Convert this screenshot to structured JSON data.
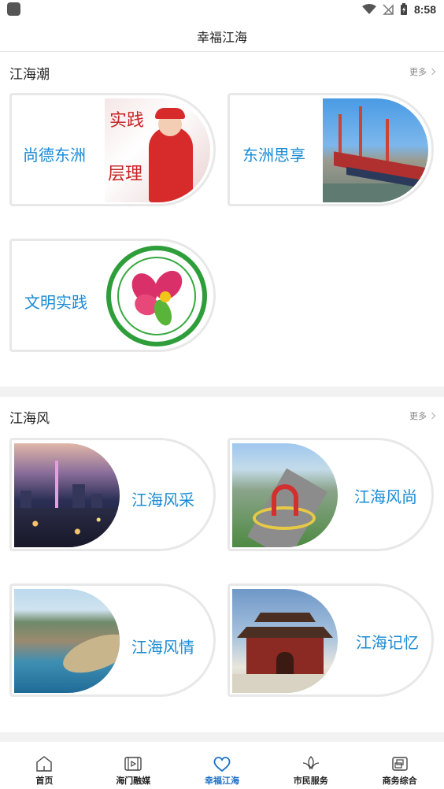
{
  "status_bar": {
    "time": "8:58"
  },
  "header": {
    "title": "幸福江海"
  },
  "sections": [
    {
      "title": "江海潮",
      "more": "更多",
      "cards": [
        {
          "label": "尚德东洲",
          "image": "volunteer-speaker-photo"
        },
        {
          "label": "东洲思享",
          "image": "shipyard-cranes-photo"
        },
        {
          "label": "文明实践",
          "image": "civilization-practice-logo"
        }
      ]
    },
    {
      "title": "江海风",
      "more": "更多",
      "cards": [
        {
          "label": "江海风采",
          "image": "city-night-skyline-photo"
        },
        {
          "label": "江海风尚",
          "image": "city-plaza-aerial-photo"
        },
        {
          "label": "江海风情",
          "image": "coastline-aerial-photo"
        },
        {
          "label": "江海记忆",
          "image": "traditional-temple-photo"
        }
      ]
    }
  ],
  "bottom_nav": [
    {
      "label": "首页",
      "icon": "home-icon",
      "active": false
    },
    {
      "label": "海门融媒",
      "icon": "media-play-icon",
      "active": false
    },
    {
      "label": "幸福江海",
      "icon": "heart-icon",
      "active": true
    },
    {
      "label": "市民服务",
      "icon": "leaf-hands-icon",
      "active": false
    },
    {
      "label": "商务综合",
      "icon": "business-icon",
      "active": false
    }
  ],
  "colors": {
    "accent": "#1a8bd4",
    "active_nav": "#1a6fc4",
    "divider": "#f2f2f2"
  }
}
